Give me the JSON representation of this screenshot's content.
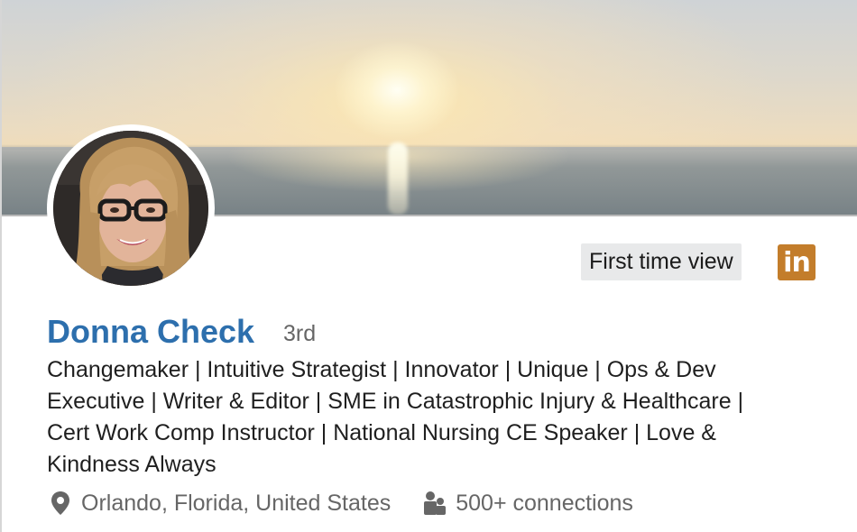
{
  "profile": {
    "name": "Donna Check",
    "degree": "3rd",
    "headline": "Changemaker | Intuitive Strategist | Innovator | Unique | Ops & Dev Executive | Writer & Editor | SME in Catastrophic Injury & Healthcare | Cert Work Comp Instructor | National Nursing CE Speaker | Love & Kindness Always",
    "location": "Orlando, Florida, United States",
    "connections": "500+ connections"
  },
  "badges": {
    "first_time_view": "First time view",
    "logo_text": "in"
  },
  "icons": {
    "location": "map-pin-icon",
    "connections": "people-icon",
    "brand": "linkedin-logo"
  },
  "colors": {
    "name": "#2d6fad",
    "logo_bg": "#c37d2b",
    "badge_bg": "#e8e9ea",
    "muted_text": "#666666"
  }
}
